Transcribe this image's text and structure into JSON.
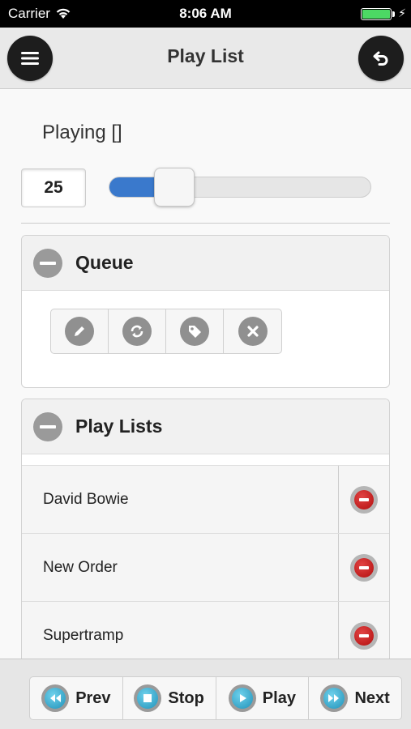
{
  "status_bar": {
    "carrier": "Carrier",
    "time": "8:06 AM",
    "battery_level": 1.0,
    "battery_color": "#4cd964"
  },
  "header": {
    "title": "Play List",
    "menu_icon": "hamburger-menu-icon",
    "back_icon": "undo-arrow-icon"
  },
  "player": {
    "playing_label": "Playing []",
    "volume_value": "25",
    "volume_fraction": 0.25,
    "accent": "#3a79cc"
  },
  "queue": {
    "title": "Queue",
    "buttons": [
      {
        "icon": "pencil-icon"
      },
      {
        "icon": "refresh-icon"
      },
      {
        "icon": "tag-icon"
      },
      {
        "icon": "delete-x-icon"
      }
    ]
  },
  "play_lists": {
    "title": "Play Lists",
    "items": [
      {
        "name": "David Bowie"
      },
      {
        "name": "New Order"
      },
      {
        "name": "Supertramp"
      }
    ]
  },
  "footer": {
    "controls": [
      {
        "label": "Prev",
        "icon": "rewind-icon"
      },
      {
        "label": "Stop",
        "icon": "stop-icon"
      },
      {
        "label": "Play",
        "icon": "play-icon"
      },
      {
        "label": "Next",
        "icon": "fast-forward-icon"
      }
    ]
  }
}
